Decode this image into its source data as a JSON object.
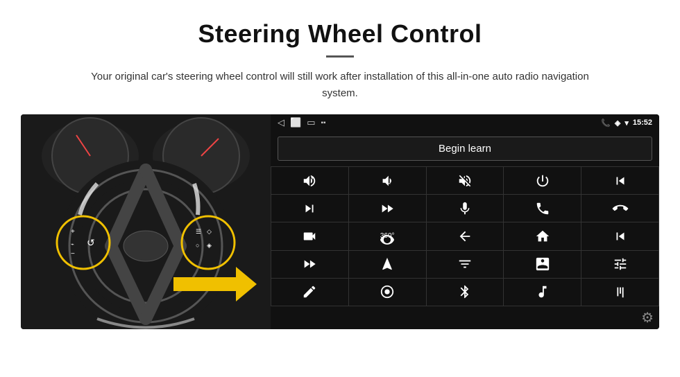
{
  "header": {
    "title": "Steering Wheel Control",
    "description": "Your original car's steering wheel control will still work after installation of this all-in-one auto radio navigation system."
  },
  "status_bar": {
    "back_icon": "◁",
    "home_icon": "□",
    "square_icon": "▭",
    "signal_icon": "▪▪",
    "phone_icon": "📞",
    "location_icon": "◈",
    "wifi_icon": "▾",
    "time": "15:52"
  },
  "begin_learn_label": "Begin learn",
  "controls": [
    {
      "id": "vol-up",
      "symbol": "vol+"
    },
    {
      "id": "vol-down",
      "symbol": "vol-"
    },
    {
      "id": "mute",
      "symbol": "mute"
    },
    {
      "id": "power",
      "symbol": "power"
    },
    {
      "id": "prev-track",
      "symbol": "prev"
    },
    {
      "id": "next",
      "symbol": "next"
    },
    {
      "id": "skip-fwd",
      "symbol": "skip+"
    },
    {
      "id": "mic",
      "symbol": "mic"
    },
    {
      "id": "phone",
      "symbol": "phone"
    },
    {
      "id": "hang",
      "symbol": "hang"
    },
    {
      "id": "cam",
      "symbol": "cam"
    },
    {
      "id": "360",
      "symbol": "360"
    },
    {
      "id": "back",
      "symbol": "back"
    },
    {
      "id": "home",
      "symbol": "home"
    },
    {
      "id": "skip-back",
      "symbol": "skipb"
    },
    {
      "id": "ff",
      "symbol": "ff"
    },
    {
      "id": "nav",
      "symbol": "nav"
    },
    {
      "id": "eq",
      "symbol": "eq"
    },
    {
      "id": "media",
      "symbol": "media"
    },
    {
      "id": "settings2",
      "symbol": "settings2"
    },
    {
      "id": "edit",
      "symbol": "edit"
    },
    {
      "id": "target",
      "symbol": "target"
    },
    {
      "id": "bt",
      "symbol": "bt"
    },
    {
      "id": "music",
      "symbol": "music"
    },
    {
      "id": "bars",
      "symbol": "bars"
    }
  ],
  "settings_icon": "⚙"
}
